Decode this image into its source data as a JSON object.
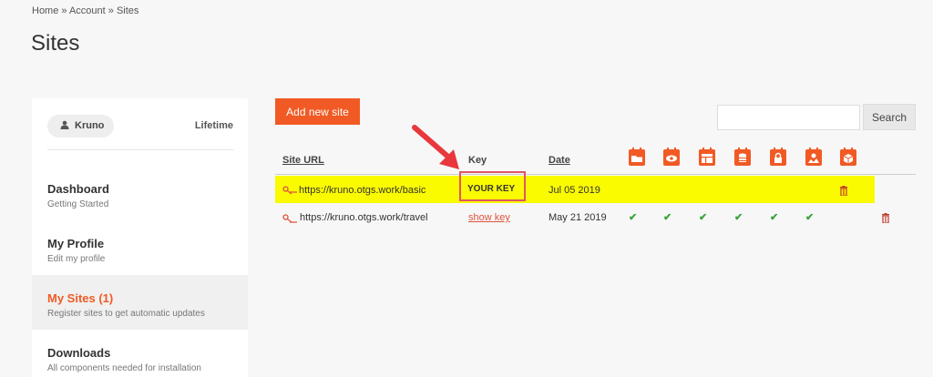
{
  "breadcrumb": "Home » Account » Sites",
  "page_title": "Sites",
  "user": {
    "name": "Kruno",
    "plan": "Lifetime"
  },
  "nav": [
    {
      "title": "Dashboard",
      "subtitle": "Getting Started"
    },
    {
      "title": "My Profile",
      "subtitle": "Edit my profile"
    },
    {
      "title": "My Sites (1)",
      "subtitle": "Register sites to get automatic updates"
    },
    {
      "title": "Downloads",
      "subtitle": "All components needed for installation"
    }
  ],
  "add_site_label": "Add new site",
  "search": {
    "button_label": "Search",
    "value": ""
  },
  "table": {
    "headers": {
      "url": "Site URL",
      "key": "Key",
      "date": "Date"
    },
    "column_icons": [
      "folder-icon",
      "eye-icon",
      "layout-icon",
      "database-icon",
      "lock-icon",
      "map-icon",
      "package-icon"
    ],
    "rows": [
      {
        "url": "https://kruno.otgs.work/basic",
        "key": "YOUR KEY",
        "date": "Jul 05 2019",
        "checks": []
      },
      {
        "url": "https://kruno.otgs.work/travel",
        "key": "show key",
        "date": "May 21 2019",
        "checks": [
          "✔",
          "✔",
          "✔",
          "✔",
          "✔",
          "✔"
        ]
      }
    ]
  },
  "colors": {
    "accent": "#f15a24",
    "highlight": "#fbfb00",
    "check": "#3aa33a",
    "annotation": "#e05566"
  }
}
